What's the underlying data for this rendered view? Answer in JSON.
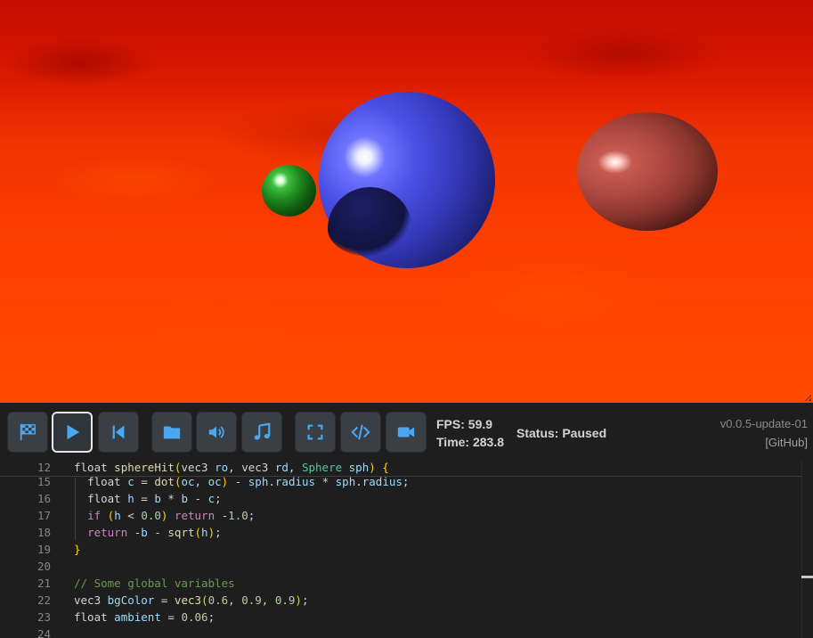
{
  "toolbar": {
    "buttons": [
      {
        "name": "compile-button",
        "icon": "checkered-flag-icon"
      },
      {
        "name": "play-button",
        "icon": "play-icon"
      },
      {
        "name": "rewind-button",
        "icon": "skip-back-icon"
      },
      {
        "name": "open-file-button",
        "icon": "folder-icon"
      },
      {
        "name": "volume-button",
        "icon": "volume-icon"
      },
      {
        "name": "music-button",
        "icon": "music-note-icon"
      },
      {
        "name": "fullscreen-button",
        "icon": "fullscreen-icon"
      },
      {
        "name": "code-toggle-button",
        "icon": "code-icon"
      },
      {
        "name": "record-button",
        "icon": "video-camera-icon"
      }
    ],
    "accent_color": "#4aa8f0",
    "fps_label": "FPS:  59.9",
    "time_label": "Time: 283.8",
    "status_label": "Status: Paused",
    "version": "v0.0.5-update-01",
    "github_link": "[GitHub]"
  },
  "scene": {
    "background_color": "#ff4200",
    "spheres": [
      "green",
      "blue",
      "red"
    ]
  },
  "editor": {
    "sticky_line": {
      "num": "12",
      "text": "float sphereHit(vec3 ro, vec3 rd, Sphere sph) {"
    },
    "lines": [
      {
        "num": "15",
        "text": "  float c = dot(oc, oc) - sph.radius * sph.radius;"
      },
      {
        "num": "16",
        "text": "  float h = b * b - c;"
      },
      {
        "num": "17",
        "text": "  if (h < 0.0) return -1.0;"
      },
      {
        "num": "18",
        "text": "  return -b - sqrt(h);"
      },
      {
        "num": "19",
        "text": "}"
      },
      {
        "num": "20",
        "text": ""
      },
      {
        "num": "21",
        "text": "// Some global variables"
      },
      {
        "num": "22",
        "text": "vec3 bgColor = vec3(0.6, 0.9, 0.9);"
      },
      {
        "num": "23",
        "text": "float ambient = 0.06;"
      },
      {
        "num": "24",
        "text": ""
      }
    ]
  }
}
